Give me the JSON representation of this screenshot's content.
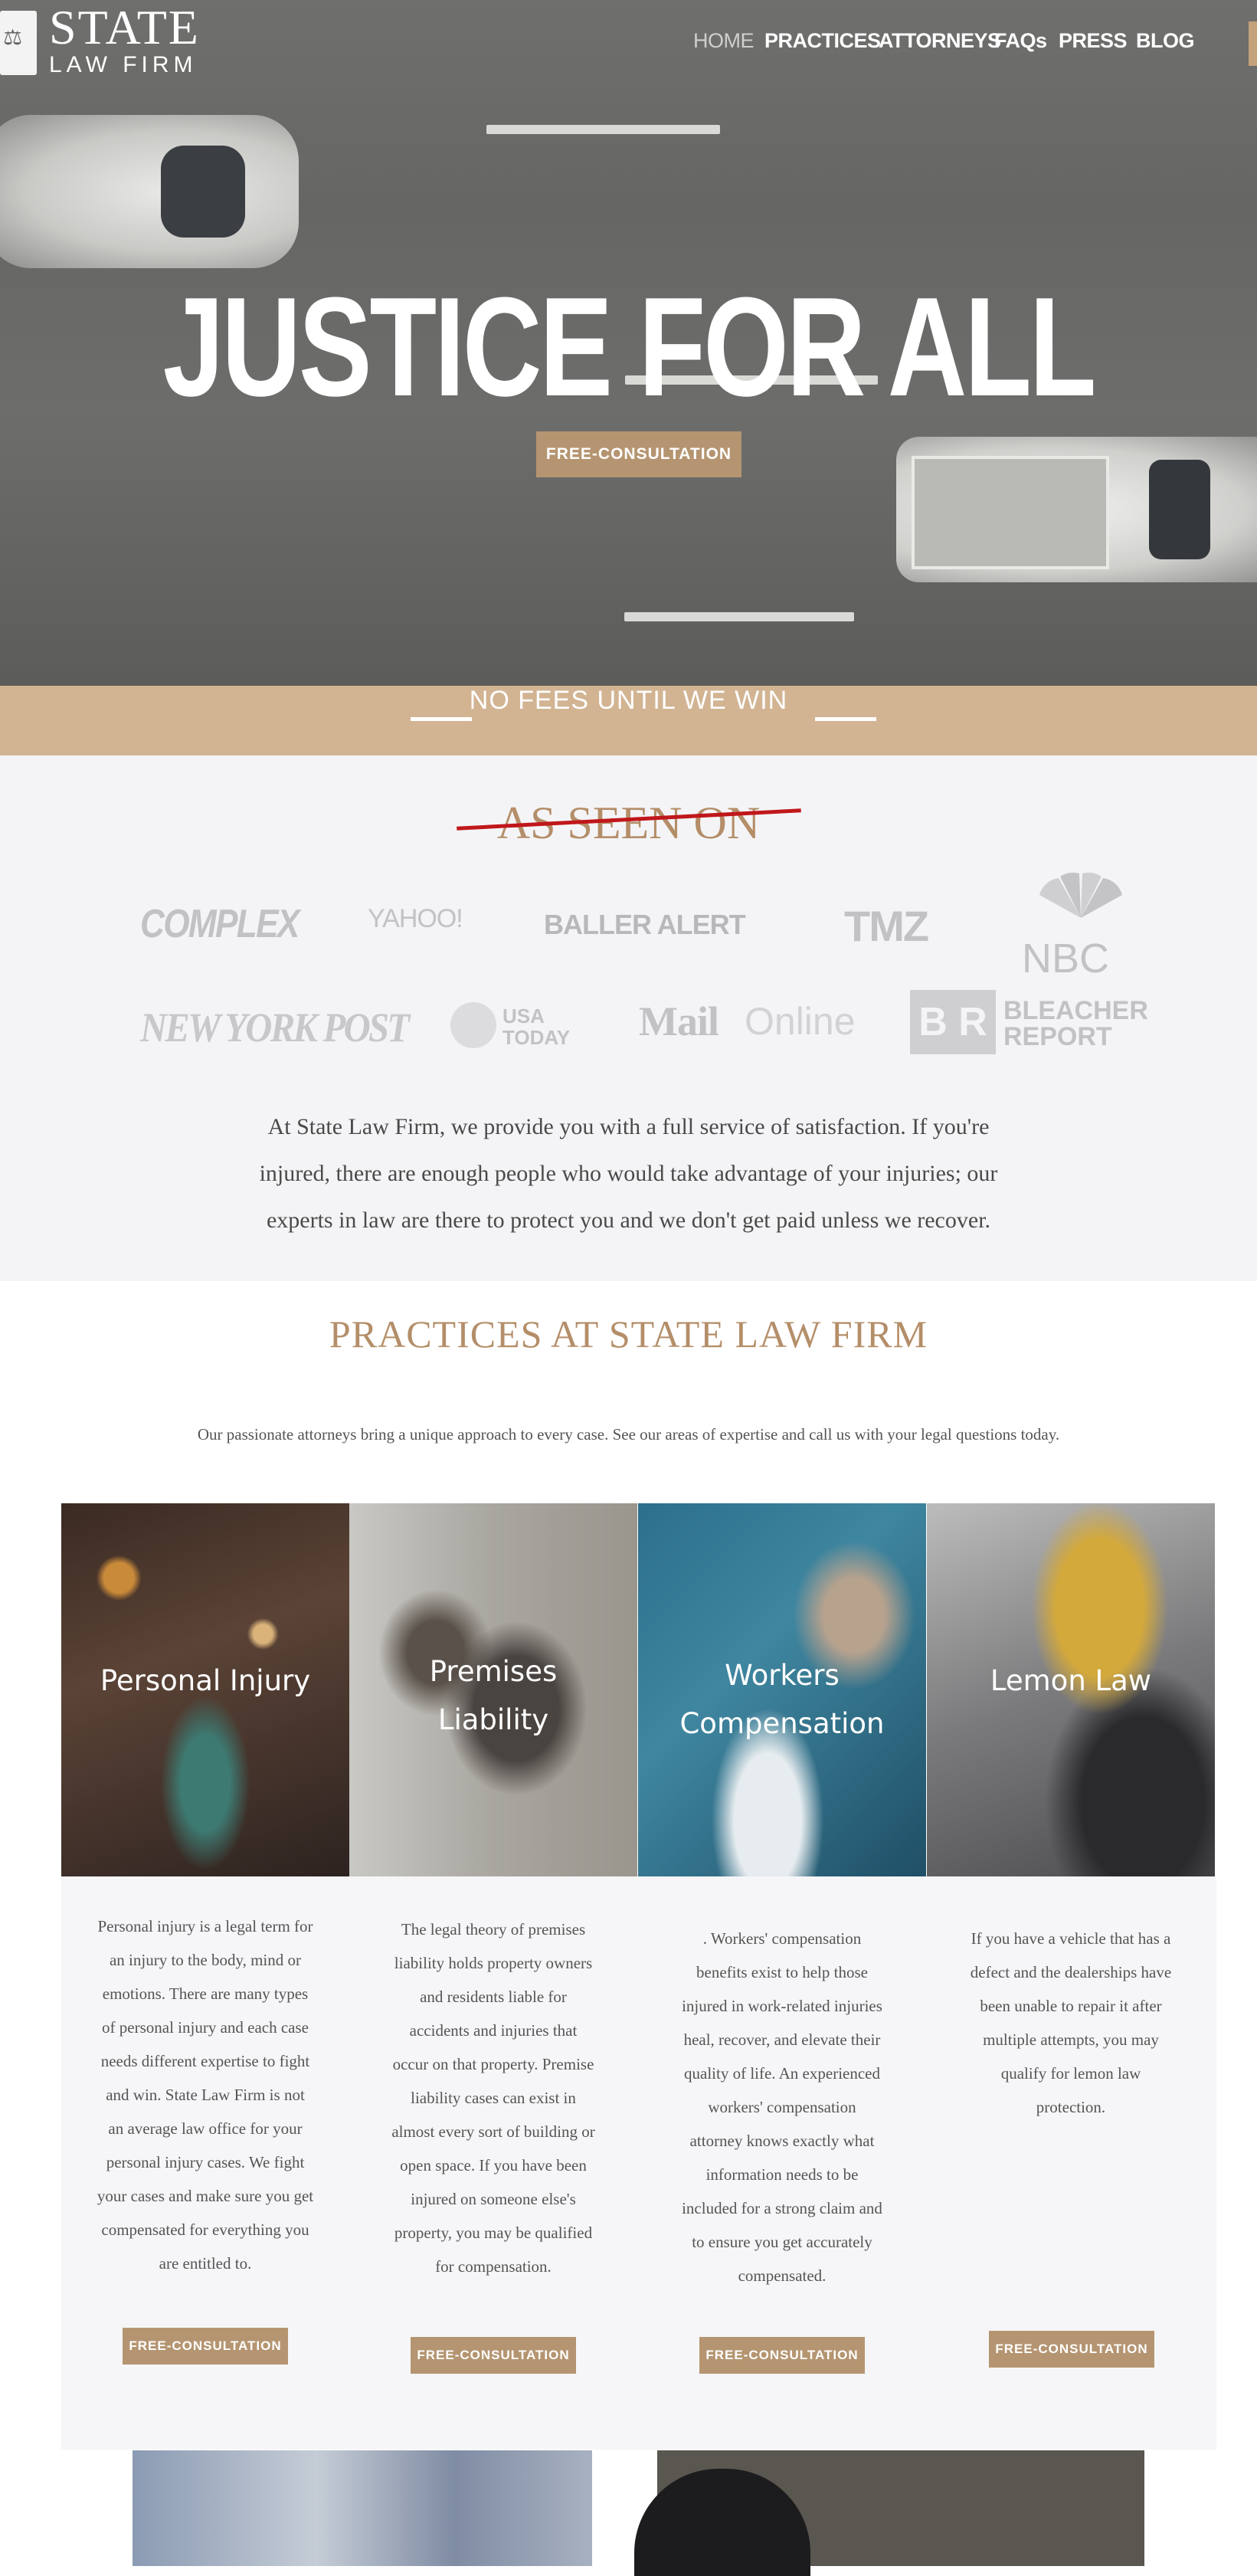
{
  "brand": {
    "name_top": "STATE",
    "name_bottom": "LAW FIRM",
    "logo_icon": "scales-of-justice-icon"
  },
  "nav": {
    "items": [
      {
        "label": "HOME",
        "active": true
      },
      {
        "label": "PRACTICES",
        "active": false
      },
      {
        "label": "ATTORNEYS",
        "active": false
      },
      {
        "label": "FAQs",
        "active": false
      },
      {
        "label": "PRESS",
        "active": false
      },
      {
        "label": "BLOG",
        "active": false
      }
    ]
  },
  "hero": {
    "title": "JUSTICE FOR ALL",
    "button": "FREE-CONSULTATION"
  },
  "band": {
    "text": "NO FEES UNTIL WE WIN"
  },
  "seen_on": {
    "title": "AS SEEN ON",
    "logos": [
      "COMPLEX",
      "YAHOO!",
      "BALLER ALERT",
      "TMZ",
      "NBC",
      "NEW YORK POST",
      "USA TODAY",
      "Mail",
      "Online",
      "B R",
      "BLEACHER",
      "REPORT"
    ]
  },
  "intro": {
    "lines": [
      "At State Law Firm, we provide you with a full service of satisfaction. If you're",
      "injured, there are enough people who would take advantage of your injuries; our",
      "experts in law are there to protect you and we don't get paid unless we recover."
    ]
  },
  "practices": {
    "title": "PRACTICES AT STATE LAW FIRM",
    "subtitle": "Our passionate attorneys bring a unique approach to every case. See our areas of expertise and call us with your legal questions today.",
    "cards": [
      {
        "label_lines": [
          "Personal Injury"
        ],
        "text_lines": [
          "Personal injury is a legal term for",
          "an injury to the body, mind or",
          "emotions. There are many types",
          "of personal injury and each case",
          "needs different expertise to fight",
          "and win. State Law Firm is not",
          "an average law office for your",
          "personal injury cases. We fight",
          "your cases and make sure you get",
          "compensated for everything you",
          "are entitled to."
        ],
        "button": "FREE-CONSULTATION"
      },
      {
        "label_lines": [
          "Premises",
          "Liability"
        ],
        "text_lines": [
          "The legal theory of premises",
          "liability holds property owners",
          "and residents liable for",
          "accidents and injuries that",
          "occur on that property. Premise",
          "liability cases can exist in",
          "almost every sort of building or",
          "open space. If you have been",
          "injured on someone else's",
          "property, you may be qualified",
          "for compensation."
        ],
        "button": "FREE-CONSULTATION"
      },
      {
        "label_lines": [
          "Workers",
          "Compensation"
        ],
        "text_lines": [
          ". Workers' compensation",
          "benefits exist to help those",
          "injured in work-related injuries",
          "heal, recover, and elevate their",
          "quality of life. An experienced",
          "workers' compensation",
          "attorney knows exactly what",
          "information needs to be",
          "included for a strong claim and",
          "to ensure you get accurately",
          "compensated."
        ],
        "button": "FREE-CONSULTATION"
      },
      {
        "label_lines": [
          "Lemon Law"
        ],
        "text_lines": [
          "If you have a vehicle that has a",
          "defect and the dealerships have",
          "been unable to repair it after",
          "multiple attempts, you may",
          "qualify for lemon law",
          "protection."
        ],
        "button": "FREE-CONSULTATION"
      }
    ]
  },
  "colors": {
    "accent": "#b59571",
    "band": "#d2b493",
    "title": "#b48e69",
    "strike": "#c0171b"
  }
}
